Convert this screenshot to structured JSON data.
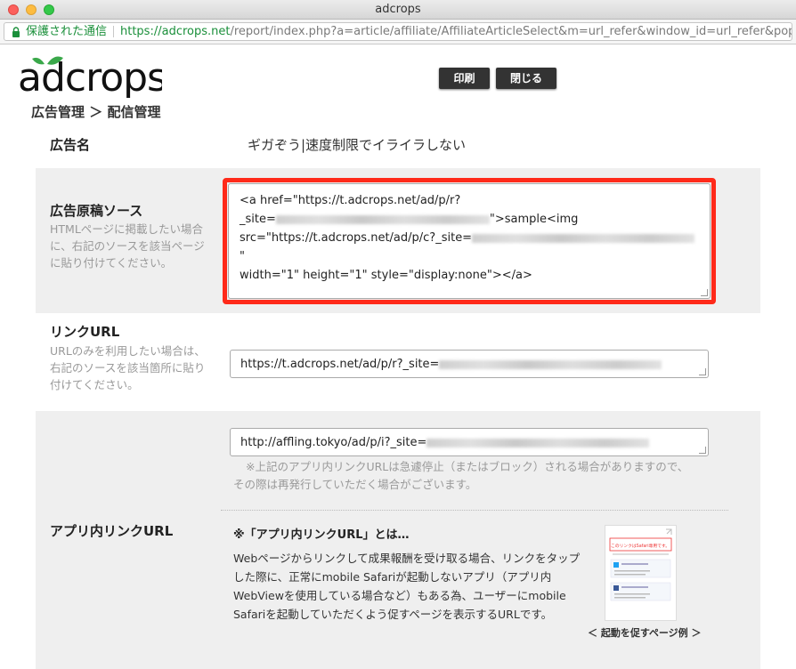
{
  "window": {
    "title": "adcrops"
  },
  "addressbar": {
    "secure_label": "保護された通信",
    "url_scheme": "https://",
    "url_host": "adcrops.net",
    "url_rest": "/report/index.php?a=article/affiliate/AffiliateArticleSelect&m=url_refer&window_id=url_refer&pop..."
  },
  "header": {
    "logo_text": "adcrops",
    "print_label": "印刷",
    "close_label": "閉じる",
    "breadcrumb": "広告管理 ＞ 配信管理"
  },
  "ad_name": {
    "label": "広告名",
    "value": "ギガぞう|速度制限でイライラしない"
  },
  "ad_source": {
    "label": "広告原稿ソース",
    "hint": "HTMLページに掲載したい場合に、右記のソースを該当ページに貼り付けてください。",
    "line1": "<a href=\"https://t.adcrops.net/ad/p/r?",
    "line2_prefix": "_site=",
    "line2_suffix": "\">sample<img",
    "line3_prefix": "src=\"https://t.adcrops.net/ad/p/c?_site=",
    "line3_suffix": "\"",
    "line4": "width=\"1\" height=\"1\" style=\"display:none\"></a>"
  },
  "link_url": {
    "label": "リンクURL",
    "hint": "URLのみを利用したい場合は、右記のソースを該当箇所に貼り付けてください。",
    "value_prefix": "https://t.adcrops.net/ad/p/r?_site="
  },
  "app_link": {
    "label": "アプリ内リンクURL",
    "value_prefix": "http://affling.tokyo/ad/p/i?_site=",
    "notice_line1": "※上記のアプリ内リンクURLは急遽停止（またはブロック）される場合がありますので、",
    "notice_line2": "その際は再発行していただく場合がございます。",
    "about_title": "※「アプリ内リンクURL」とは…",
    "about_body": "Webページからリンクして成果報酬を受け取る場合、リンクをタップした際に、正常にmobile Safariが起動しないアプリ（アプリ内WebViewを使用している場合など）もある為、ユーザーにmobile Safariを起動していただくよう促すページを表示するURLです。",
    "thumb_heading": "このリンクはSafari専用です。",
    "thumb_caption": "＜ 起動を促すページ例 ＞"
  },
  "colors": {
    "accent_red": "#ff2a1a",
    "secure_green": "#1a8f3a",
    "logo_green": "#3aa84a",
    "band_gray": "#efefef"
  }
}
